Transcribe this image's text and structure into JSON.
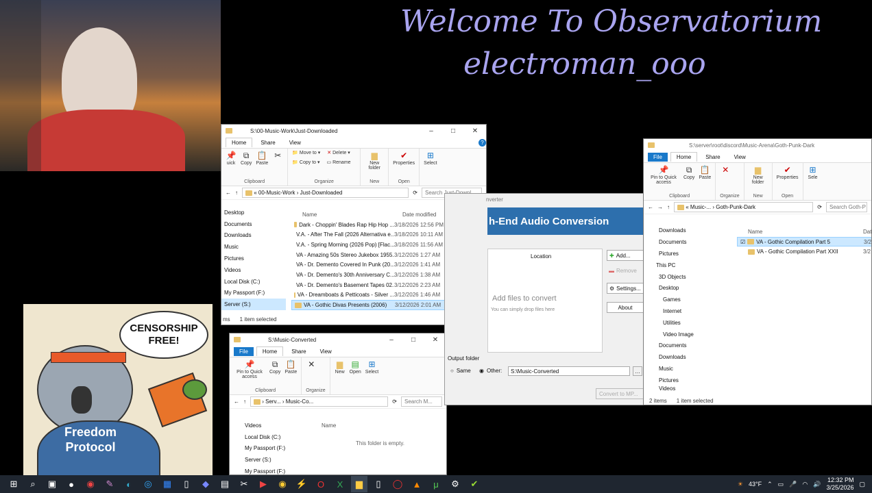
{
  "stream": {
    "title_line1": "Welcome To Observatorium",
    "title_line2": "electroman_ooo"
  },
  "sticker": {
    "bubble": "CENSORSHIP FREE!",
    "shirt_line1": "Freedom",
    "shirt_line2": "Protocol"
  },
  "win1": {
    "path": "S:\\00-Music-Work\\Just-Downloaded",
    "tabs": [
      "Home",
      "Share",
      "View"
    ],
    "ribbon": {
      "quick": "uick",
      "copy": "Copy",
      "paste": "Paste",
      "clipboard": "Clipboard",
      "move_to": "Move to",
      "copy_to": "Copy to",
      "delete": "Delete",
      "rename": "Rename",
      "organize": "Organize",
      "new_folder": "New folder",
      "new": "New",
      "properties": "Properties",
      "open": "Open",
      "select": "Select"
    },
    "crumb1": "00-Music-Work",
    "crumb2": "Just-Downloaded",
    "search": "Search Just-Downl...",
    "col_name": "Name",
    "col_date": "Date modified",
    "nav": [
      "Desktop",
      "Documents",
      "Downloads",
      "Music",
      "Pictures",
      "Videos",
      "Local Disk (C:)",
      "My Passport (F:)",
      "Server (S:)"
    ],
    "rows": [
      {
        "name": "Dark - Choppin' Blades Rap Hip Hop ...",
        "date": "3/18/2026 12:56 PM"
      },
      {
        "name": "V.A. - After The Fall (2026 Alternativa e...",
        "date": "3/18/2026 10:11 AM"
      },
      {
        "name": "V.A. - Spring Morning (2026 Pop) [Flac...",
        "date": "3/18/2026 11:56 AM"
      },
      {
        "name": "VA - Amazing 50s Stereo Jukebox 1955...",
        "date": "3/12/2026 1:27 AM"
      },
      {
        "name": "VA - Dr. Demento Covered In Punk (20...",
        "date": "3/12/2026 1:41 AM"
      },
      {
        "name": "VA - Dr. Demento's 30th Anniversary C...",
        "date": "3/12/2026 1:38 AM"
      },
      {
        "name": "VA - Dr. Demento's Basement Tapes 02...",
        "date": "3/12/2026 2:23 AM"
      },
      {
        "name": "VA - Dreamboats & Petticoats - Silver ...",
        "date": "3/12/2026 1:46 AM"
      },
      {
        "name": "VA - Gothic Divas Presents (2006)",
        "date": "3/12/2026 2:01 AM"
      }
    ],
    "status_count": "ms",
    "status_sel": "1 item selected"
  },
  "win2": {
    "path": "S:\\Music-Converted",
    "tabs": [
      "File",
      "Home",
      "Share",
      "View"
    ],
    "ribbon": {
      "pin": "Pin to Quick access",
      "copy": "Copy",
      "paste": "Paste",
      "clipboard": "Clipboard",
      "organize": "Organize",
      "new": "New",
      "open": "Open",
      "select": "Select"
    },
    "crumb1": "Serv...",
    "crumb2": "Music-Co...",
    "search": "Search M...",
    "nav": [
      "Videos",
      "Local Disk (C:)",
      "My Passport (F:)",
      "Server (S:)",
      "My Passport (F:)"
    ],
    "col_name": "Name",
    "empty": "This folder is empty."
  },
  "conv": {
    "title": "nverter",
    "heading": "h-End Audio Conversion",
    "location": "Location",
    "add": "Add...",
    "remove": "Remove",
    "settings": "Settings...",
    "about": "About",
    "drop": "Add files to convert",
    "drop_sub": "You can simply drop files here",
    "output_folder": "Output folder",
    "same": "Same",
    "other": "Other:",
    "other_path": "S:\\Music-Converted",
    "convert": "Convert to MP..."
  },
  "win3": {
    "path": "S:\\server\\root\\discord\\Music-Arena\\Goth-Punk-Dark",
    "tabs": [
      "File",
      "Home",
      "Share",
      "View"
    ],
    "ribbon": {
      "pin": "Pin to Quick access",
      "copy": "Copy",
      "paste": "Paste",
      "clipboard": "Clipboard",
      "organize": "Organize",
      "new_folder": "New folder",
      "new": "New",
      "properties": "Properties",
      "open": "Open",
      "select": "Sele"
    },
    "crumb1": "Music-...",
    "crumb2": "Goth-Punk-Dark",
    "search": "Search Goth-P",
    "col_name": "Name",
    "col_date": "Dat",
    "nav": [
      "Downloads",
      "Documents",
      "Pictures",
      "This PC",
      "3D Objects",
      "Desktop",
      "Games",
      "Internet",
      "Utilities",
      "Video Image",
      "Documents",
      "Downloads",
      "Music",
      "Pictures",
      "Videos"
    ],
    "rows": [
      {
        "name": "VA - Gothic Compilation Part 5",
        "date": "3/2"
      },
      {
        "name": "VA - Gothic Compilation Part XXII",
        "date": "3/2"
      }
    ],
    "status_count": "2 items",
    "status_sel": "1 item selected"
  },
  "taskbar": {
    "temp": "43°F",
    "time": "12:32 PM",
    "date": "3/25/2026"
  }
}
